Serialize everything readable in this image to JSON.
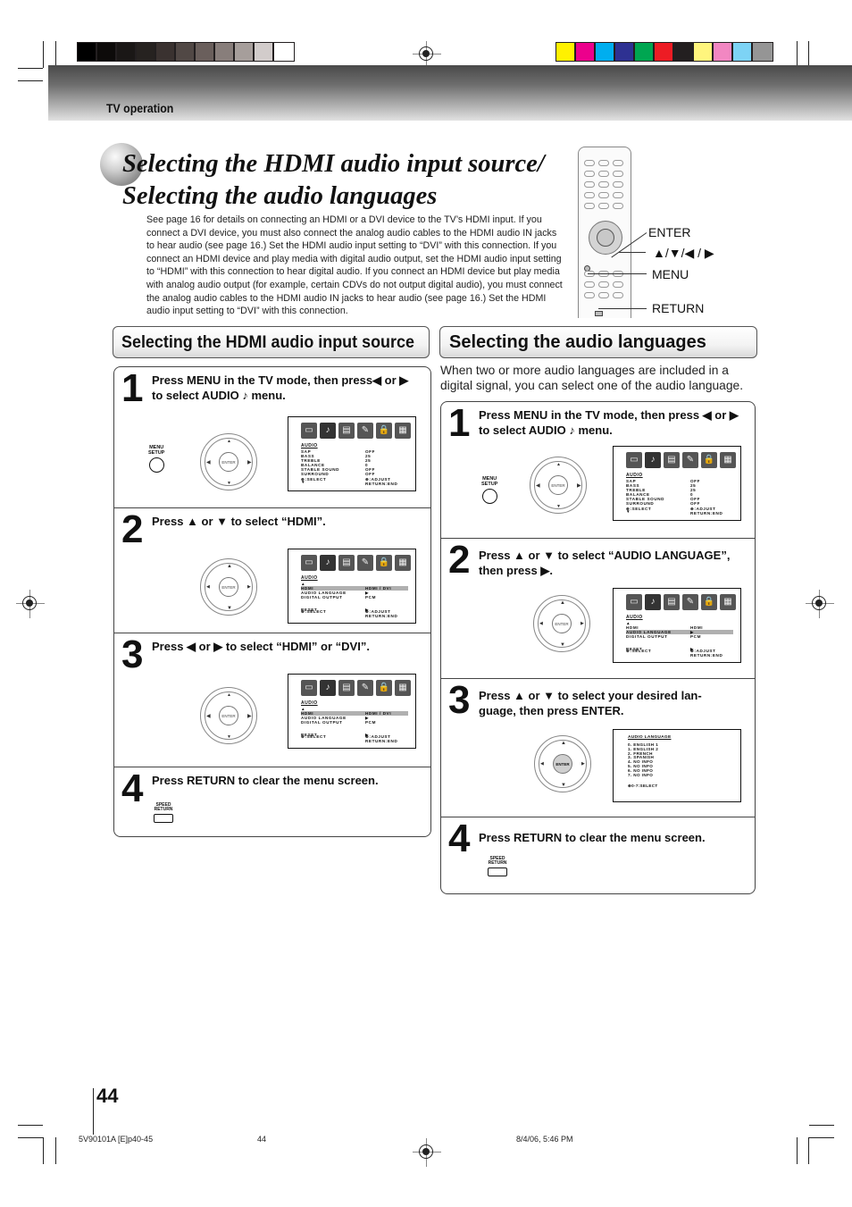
{
  "header": {
    "section_label": "TV operation",
    "grayscale_swatches": [
      "#000000",
      "#0d0b0a",
      "#1a1716",
      "#262220",
      "#3a3230",
      "#514845",
      "#6a5f5c",
      "#887e7b",
      "#a69e9b",
      "#d2cccb",
      "#ffffff"
    ],
    "color_swatches": [
      "#fff100",
      "#ec008c",
      "#00aeef",
      "#2e3192",
      "#00a651",
      "#ed1c24",
      "#231f20",
      "#fff57d",
      "#f287c2",
      "#7dd3f5",
      "#959595"
    ]
  },
  "title": {
    "line1": "Selecting the HDMI audio input source/",
    "line2": "Selecting the audio languages"
  },
  "intro": "See page 16 for details on connecting an HDMI or a DVI device to the TV’s HDMI input. If you connect a DVI device, you must also connect the analog audio cables to the HDMI audio IN jacks to hear audio (see page 16.) Set the HDMI audio input setting to “DVI” with this connection. If you connect an HDMI device and play media with digital audio output, set the HDMI audio input setting to “HDMI” with this connection to hear digital audio. If you connect an HDMI device but play media with analog audio output (for example, certain CDVs do not output digital audio), you must connect the analog audio cables to the HDMI audio IN jacks to hear audio (see page 16.) Set the HDMI audio input setting to “DVI” with this connection.",
  "remote": {
    "labels": {
      "enter": "ENTER",
      "arrows": "▲/▼/◀ / ▶",
      "menu": "MENU",
      "return": "RETURN"
    }
  },
  "hdmi_section": {
    "heading": "Selecting the HDMI audio input source",
    "steps": [
      {
        "num": "1",
        "text": "Press MENU in the TV mode, then press◀ or ▶ to select AUDIO ♪ menu."
      },
      {
        "num": "2",
        "text": "Press ▲ or ▼ to select “HDMI”."
      },
      {
        "num": "3",
        "text": "Press ◀ or ▶ to select “HDMI” or “DVI”."
      },
      {
        "num": "4",
        "text": "Press RETURN to clear the menu screen."
      }
    ]
  },
  "lang_section": {
    "heading": "Selecting the audio languages",
    "description": "When two or more audio languages are included in a digital signal, you can select one of the audio language.",
    "steps": [
      {
        "num": "1",
        "text": "Press MENU in the TV mode, then press ◀ or ▶ to select AUDIO ♪ menu."
      },
      {
        "num": "2",
        "text": "Press ▲ or ▼ to select “AUDIO LANGUAGE”, then press ▶."
      },
      {
        "num": "3",
        "text": "Press ▲ or ▼ to select your desired lan- guage, then press ENTER."
      },
      {
        "num": "4",
        "text": "Press RETURN to clear the menu screen."
      }
    ]
  },
  "buttons": {
    "menu_line1": "MENU",
    "menu_line2": "SETUP",
    "return_line1": "SPEED",
    "return_line2": "RETURN",
    "enter": "ENTER"
  },
  "osd": {
    "heading": "AUDIO",
    "audio_menu": [
      {
        "key": "SAP",
        "value": "OFF"
      },
      {
        "key": "BASS",
        "value": "25"
      },
      {
        "key": "TREBLE",
        "value": "25"
      },
      {
        "key": "BALANCE",
        "value": "0"
      },
      {
        "key": "STABLE SOUND",
        "value": "OFF"
      },
      {
        "key": "SURROUND",
        "value": "OFF"
      }
    ],
    "hdmi_menu": [
      {
        "key": "HDMI",
        "value": "HDMI / DVI"
      },
      {
        "key": "AUDIO LANGUAGE",
        "value": "▶"
      },
      {
        "key": "DIGITAL OUTPUT",
        "value": "PCM"
      },
      {
        "key": "RESET",
        "value": "▶"
      }
    ],
    "hdmi_value_only": "HDMI",
    "footer_select": ":SELECT",
    "footer_adjust": ":ADJUST",
    "footer_return": "RETURN:END",
    "lang_heading": "AUDIO LANGUAGE",
    "lang_list": [
      "0.  ENGLISH 1",
      "1.  ENGLISH 2",
      "2.  FRENCH",
      "3.  SPANISH",
      "4.  NO INFO",
      "5.  NO INFO",
      "6.  NO INFO",
      "7.  NO INFO"
    ],
    "lang_footer": "0-7:SELECT"
  },
  "footer": {
    "page_number": "44",
    "file_name": "5V90101A [E]p40-45",
    "sheet_number": "44",
    "timestamp": "8/4/06, 5:46 PM"
  }
}
